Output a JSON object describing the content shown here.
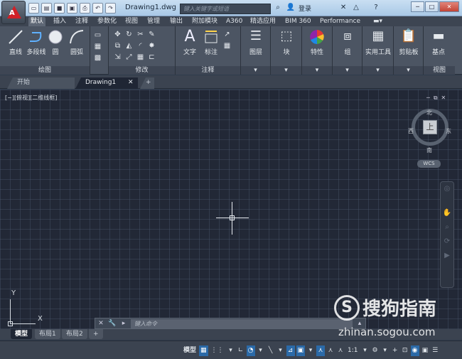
{
  "window": {
    "doc_title": "Drawing1.dwg",
    "search_placeholder": "键入关键字或短语",
    "login_label": "登录",
    "help_label": "?"
  },
  "menu_tabs": [
    "默认",
    "插入",
    "注释",
    "参数化",
    "视图",
    "管理",
    "输出",
    "附加模块",
    "A360",
    "精选应用",
    "BIM 360",
    "Performance"
  ],
  "ribbon": {
    "draw": {
      "buttons": [
        "直线",
        "多段线",
        "圆",
        "圆弧"
      ],
      "panel_label": "绘图"
    },
    "modify": {
      "panel_label": "修改"
    },
    "annotation": {
      "buttons": [
        "文字",
        "标注"
      ],
      "panel_label": "注释"
    },
    "others": [
      "图层",
      "块",
      "特性",
      "组",
      "实用工具",
      "剪贴板"
    ],
    "view": {
      "base": "基点",
      "panel_label": "视图"
    }
  },
  "file_tabs": [
    "开始",
    "Drawing1"
  ],
  "viewport": {
    "label": "[−][俯视][二维线框]",
    "compass": {
      "n": "北",
      "s": "南",
      "e": "东",
      "w": "西"
    },
    "cube_face": "上",
    "wcs": "WCS"
  },
  "ucs": {
    "x": "X",
    "y": "Y"
  },
  "command": {
    "placeholder": "键入命令"
  },
  "layout_tabs": [
    "模型",
    "布局1",
    "布局2"
  ],
  "status": {
    "model": "模型",
    "scale": "1:1"
  },
  "watermark": {
    "brand": "搜狗指南",
    "url": "zhinan.sogou.com"
  },
  "colors": {
    "accent": "#2b6aa8",
    "app_red": "#d02027"
  }
}
